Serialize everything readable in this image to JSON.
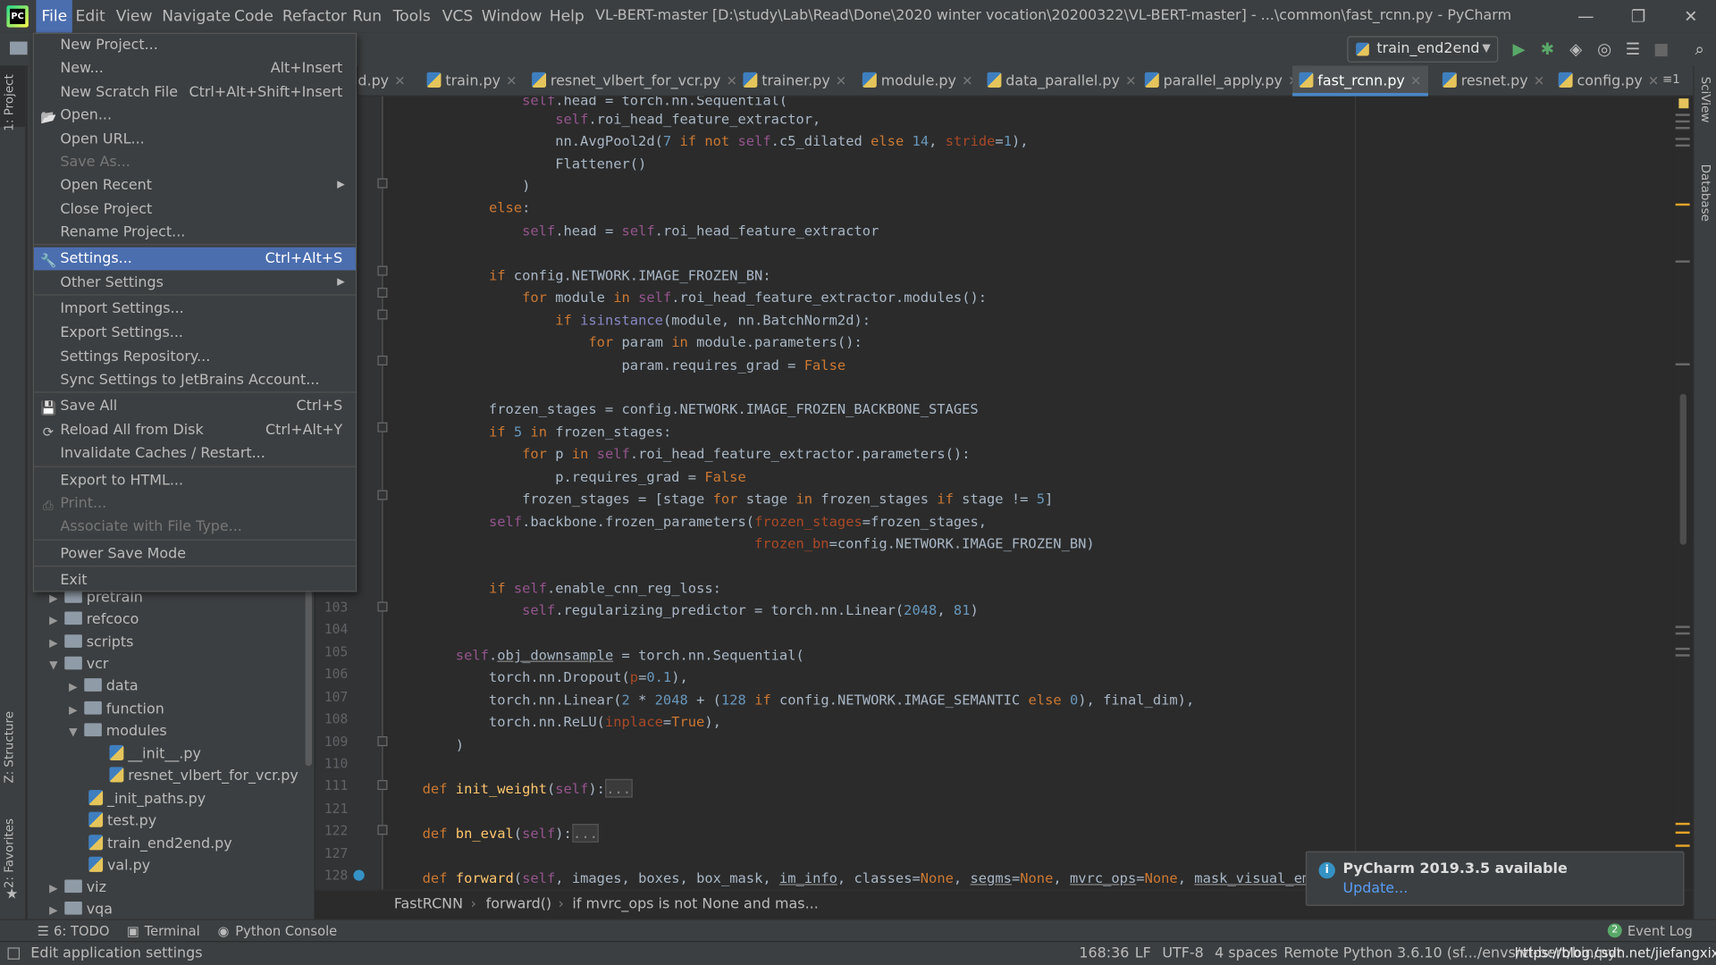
{
  "titlebar": {
    "menus": [
      "File",
      "Edit",
      "View",
      "Navigate",
      "Code",
      "Refactor",
      "Run",
      "Tools",
      "VCS",
      "Window",
      "Help"
    ],
    "active_menu": "File",
    "title": "VL-BERT-master [D:\\study\\Lab\\Read\\Done\\2020 winter vocation\\20200322\\VL-BERT-master] - ...\\common\\fast_rcnn.py - PyCharm",
    "minimize": "—",
    "restore": "❐",
    "close": "✕"
  },
  "toolbar": {
    "run_config": "train_end2end",
    "run_icon": "run-icon",
    "debug_icon": "debug-icon",
    "search_icon": "search-icon"
  },
  "tabs": [
    {
      "label": "d.py",
      "active": false
    },
    {
      "label": "train.py",
      "active": false
    },
    {
      "label": "resnet_vlbert_for_vcr.py",
      "active": false
    },
    {
      "label": "trainer.py",
      "active": false
    },
    {
      "label": "module.py",
      "active": false
    },
    {
      "label": "data_parallel.py",
      "active": false
    },
    {
      "label": "parallel_apply.py",
      "active": false
    },
    {
      "label": "fast_rcnn.py",
      "active": true
    },
    {
      "label": "resnet.py",
      "active": false
    },
    {
      "label": "config.py",
      "active": false
    }
  ],
  "tab_overflow": "≡1",
  "side_tabs": {
    "project": "1: Project",
    "structure": "Z: Structure",
    "favorites": "2: Favorites",
    "sciview": "SciView",
    "database": "Database"
  },
  "file_menu": {
    "items": [
      {
        "label": "New Project...",
        "shortcut": ""
      },
      {
        "label": "New...",
        "shortcut": "Alt+Insert"
      },
      {
        "label": "New Scratch File",
        "shortcut": "Ctrl+Alt+Shift+Insert"
      },
      {
        "label": "Open...",
        "shortcut": ""
      },
      {
        "label": "Open URL...",
        "shortcut": ""
      },
      {
        "label": "Save As...",
        "shortcut": ""
      },
      {
        "label": "Open Recent",
        "shortcut": ""
      },
      {
        "label": "Close Project",
        "shortcut": ""
      },
      {
        "label": "Rename Project...",
        "shortcut": ""
      },
      {
        "label": "Settings...",
        "shortcut": "Ctrl+Alt+S"
      },
      {
        "label": "Other Settings",
        "shortcut": ""
      },
      {
        "label": "Import Settings...",
        "shortcut": ""
      },
      {
        "label": "Export Settings...",
        "shortcut": ""
      },
      {
        "label": "Settings Repository...",
        "shortcut": ""
      },
      {
        "label": "Sync Settings to JetBrains Account...",
        "shortcut": ""
      },
      {
        "label": "Save All",
        "shortcut": "Ctrl+S"
      },
      {
        "label": "Reload All from Disk",
        "shortcut": "Ctrl+Alt+Y"
      },
      {
        "label": "Invalidate Caches / Restart...",
        "shortcut": ""
      },
      {
        "label": "Export to HTML...",
        "shortcut": ""
      },
      {
        "label": "Print...",
        "shortcut": ""
      },
      {
        "label": "Associate with File Type...",
        "shortcut": ""
      },
      {
        "label": "Power Save Mode",
        "shortcut": ""
      },
      {
        "label": "Exit",
        "shortcut": ""
      }
    ]
  },
  "project_tree": [
    {
      "label": "pretrain",
      "type": "folder",
      "expanded": false
    },
    {
      "label": "refcoco",
      "type": "folder",
      "expanded": false
    },
    {
      "label": "scripts",
      "type": "folder",
      "expanded": false
    },
    {
      "label": "vcr",
      "type": "folder",
      "expanded": true
    },
    {
      "label": "data",
      "type": "folder",
      "expanded": false
    },
    {
      "label": "function",
      "type": "folder",
      "expanded": false
    },
    {
      "label": "modules",
      "type": "folder",
      "expanded": true
    },
    {
      "label": "__init__.py",
      "type": "file"
    },
    {
      "label": "resnet_vlbert_for_vcr.py",
      "type": "file"
    },
    {
      "label": "_init_paths.py",
      "type": "file"
    },
    {
      "label": "test.py",
      "type": "file"
    },
    {
      "label": "train_end2end.py",
      "type": "file"
    },
    {
      "label": "val.py",
      "type": "file"
    },
    {
      "label": "viz",
      "type": "folder",
      "expanded": false
    },
    {
      "label": "vqa",
      "type": "folder",
      "expanded": false
    }
  ],
  "line_numbers": [
    "103",
    "104",
    "105",
    "106",
    "107",
    "108",
    "109",
    "110",
    "111",
    "121",
    "122",
    "127",
    "128"
  ],
  "breadcrumb": [
    "FastRCNN",
    "forward()",
    "if mvrc_ops is not None and mas..."
  ],
  "bottom_tools": [
    "6: TODO",
    "Terminal",
    "Python Console"
  ],
  "event_log": {
    "count": "2",
    "label": "Event Log"
  },
  "notification": {
    "title": "PyCharm 2019.3.5 available",
    "link": "Update..."
  },
  "status": {
    "message": "Edit application settings",
    "position": "168:36",
    "line_sep": "LF",
    "encoding": "UTF-8",
    "indent": "4 spaces",
    "interpreter": "Remote Python 3.6.10 (sf.../envs/vl-bert/bin/python)",
    "watermark": "https://blog.csdn.net/jiefangxix"
  }
}
